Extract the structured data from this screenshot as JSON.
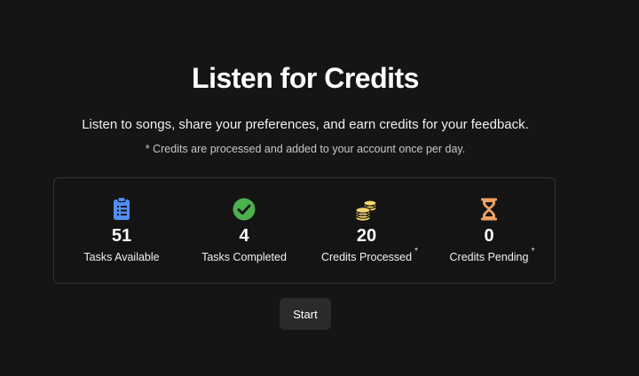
{
  "header": {
    "title": "Listen for Credits",
    "subtitle": "Listen to songs, share your preferences, and earn credits for your feedback.",
    "note": "* Credits are processed and added to your account once per day."
  },
  "stats": [
    {
      "icon": "clipboard-list-icon",
      "icon_color": "#4f8ff7",
      "value": "51",
      "label": "Tasks Available",
      "asterisk": ""
    },
    {
      "icon": "check-circle-icon",
      "icon_color": "#4caf50",
      "value": "4",
      "label": "Tasks Completed",
      "asterisk": ""
    },
    {
      "icon": "coins-icon",
      "icon_color": "#f5d76e",
      "value": "20",
      "label": "Credits Processed",
      "asterisk": "*"
    },
    {
      "icon": "hourglass-icon",
      "icon_color": "#f0a062",
      "value": "0",
      "label": "Credits Pending",
      "asterisk": "*"
    }
  ],
  "actions": {
    "start_label": "Start"
  }
}
